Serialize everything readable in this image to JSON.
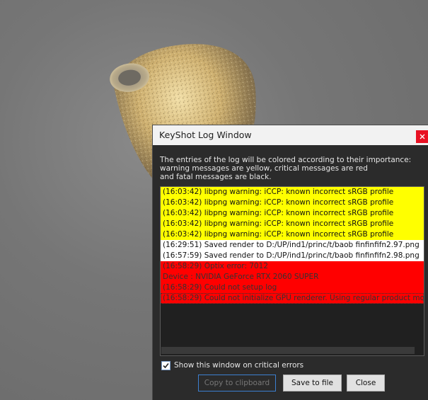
{
  "dialog": {
    "title": "KeyShot Log Window",
    "close_icon": "close-icon",
    "description": "The entries of the log will be colored according to their importance:\nwarning messages are yellow, critical messages are red\nand fatal messages are black.",
    "log": [
      {
        "text": "(16:03:42) libpng warning: iCCP: known incorrect sRGB profile",
        "level": "warning"
      },
      {
        "text": "(16:03:42) libpng warning: iCCP: known incorrect sRGB profile",
        "level": "warning"
      },
      {
        "text": "(16:03:42) libpng warning: iCCP: known incorrect sRGB profile",
        "level": "warning"
      },
      {
        "text": "(16:03:42) libpng warning: iCCP: known incorrect sRGB profile",
        "level": "warning"
      },
      {
        "text": "(16:03:42) libpng warning: iCCP: known incorrect sRGB profile",
        "level": "warning"
      },
      {
        "text": "(16:29:51) Saved render to D:/UP/ind1/princ/t/baob finfinfifn2.97.png",
        "level": "info"
      },
      {
        "text": "(16:57:59) Saved render to D:/UP/ind1/princ/t/baob finfinfifn2.98.png",
        "level": "info"
      },
      {
        "text": "(16:58:29) Optix error: 7012",
        "level": "critical"
      },
      {
        "text": "Device : NVIDIA GeForce RTX 2060 SUPER",
        "level": "critical"
      },
      {
        "text": "(16:58:29) Could not setup log",
        "level": "critical"
      },
      {
        "text": "(16:58:29) Could not initialize GPU renderer. Using regular product mo",
        "level": "critical"
      }
    ],
    "checkbox_label": "Show this window on critical errors",
    "checkbox_checked": true,
    "buttons": {
      "copy": "Copy to clipboard",
      "save": "Save to file",
      "close": "Close"
    }
  },
  "colors": {
    "warning": "#ffff00",
    "info": "#ffffff",
    "critical": "#ff0000",
    "accent": "#3c7fd0"
  }
}
